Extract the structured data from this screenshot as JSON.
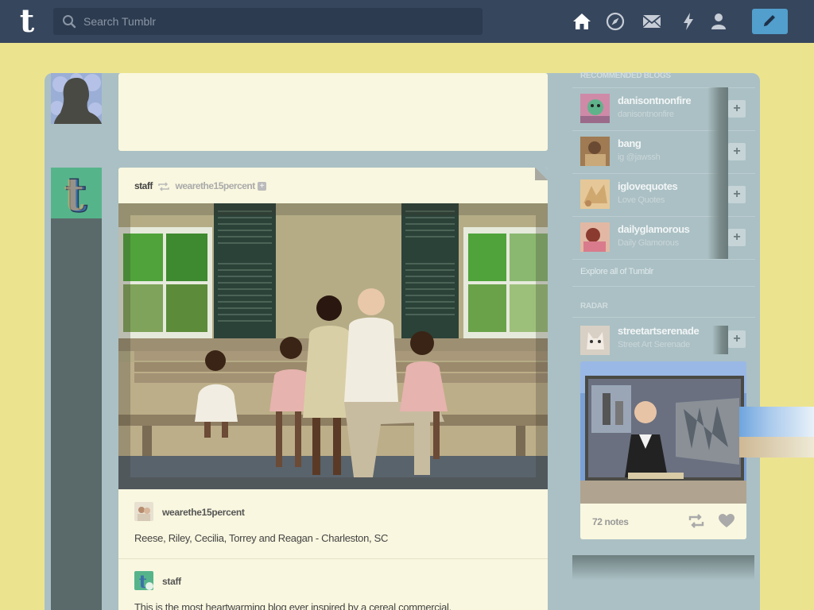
{
  "topbar": {
    "logo": "t",
    "search_placeholder": "Search Tumblr",
    "nav": [
      "home-icon",
      "explore-icon",
      "inbox-icon",
      "activity-icon",
      "account-icon"
    ],
    "compose_icon": "pencil-icon"
  },
  "posts": [
    {
      "blog": "staff",
      "reblogged_from": "wearethe15percent",
      "source_blog": "wearethe15percent",
      "caption": "Reese, Riley, Cecilia, Torrey and Reagan - Charleston, SC",
      "comment_blog": "staff",
      "comment_text": "This is the most heartwarming blog ever inspired by a cereal commercial."
    }
  ],
  "sidebar": {
    "recommended_heading": "RECOMMENDED BLOGS",
    "recommended": [
      {
        "name": "danisontnonfire",
        "title": "danisontnonfire"
      },
      {
        "name": "bang",
        "title": "ig @jawssh"
      },
      {
        "name": "iglovequotes",
        "title": "Love Quotes"
      },
      {
        "name": "dailyglamorous",
        "title": "Daily Glamorous"
      }
    ],
    "explore": "Explore all of Tumblr",
    "radar_heading": "RADAR",
    "radar": {
      "name": "streetartserenade",
      "title": "Street Art Serenade",
      "notes": "72 notes"
    }
  },
  "colors": {
    "topbar": "#36465d",
    "background": "#ece38f",
    "dashboard": "#aac0c4",
    "post": "#f9f7df",
    "compose": "#529ecc"
  }
}
